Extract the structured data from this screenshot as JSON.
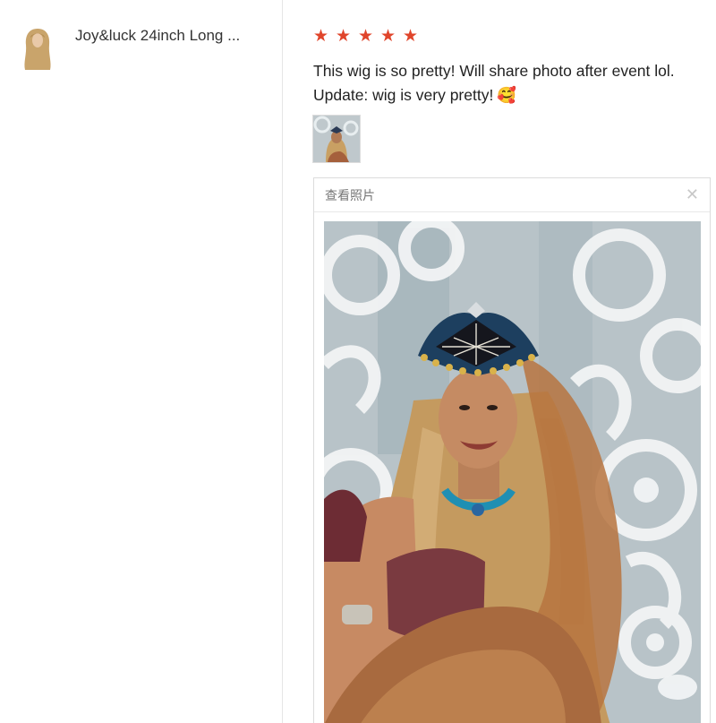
{
  "product": {
    "name": "Joy&luck 24inch Long ...",
    "thumbnail_icon": "wig-thumbnail"
  },
  "review": {
    "rating": 5,
    "stars": [
      "★",
      "★",
      "★",
      "★",
      "★"
    ],
    "star_color": "#e0452b",
    "line1": "This wig is so pretty! Will share photo after event lol.",
    "line2": "Update: wig is very pretty!",
    "emoji": "🥰",
    "photo_thumbnail_icon": "review-photo-thumbnail"
  },
  "viewer": {
    "title": "查看照片",
    "close": "✕",
    "photo_icon": "review-photo-large"
  }
}
